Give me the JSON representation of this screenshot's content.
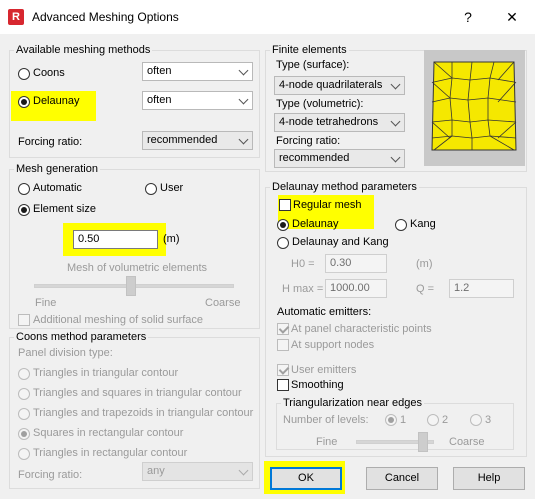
{
  "window": {
    "title": "Advanced Meshing Options",
    "help_glyph": "?",
    "close_glyph": "✕",
    "app_icon_text": "R"
  },
  "available_methods": {
    "title": "Available meshing methods",
    "coons_label": "Coons",
    "coons_select": "often",
    "delaunay_label": "Delaunay",
    "delaunay_select": "often",
    "forcing_label": "Forcing ratio:",
    "forcing_select": "recommended"
  },
  "finite_elements": {
    "title": "Finite elements",
    "surface_label": "Type (surface):",
    "surface_select": "4-node quadrilaterals",
    "volumetric_label": "Type (volumetric):",
    "volumetric_select": "4-node tetrahedrons",
    "forcing_label": "Forcing ratio:",
    "forcing_select": "recommended"
  },
  "mesh_generation": {
    "title": "Mesh generation",
    "automatic_label": "Automatic",
    "user_label": "User",
    "element_size_label": "Element size",
    "element_size_value": "0.50",
    "unit": "(m)",
    "volumetric_label": "Mesh of volumetric elements",
    "fine_label": "Fine",
    "coarse_label": "Coarse",
    "additional_label": "Additional meshing of solid surface"
  },
  "coons_params": {
    "title": "Coons method parameters",
    "division_label": "Panel division type:",
    "options": [
      "Triangles in triangular contour",
      "Triangles and squares in triangular contour",
      "Triangles and trapezoids in triangular contour",
      "Squares in rectangular contour",
      "Triangles in rectangular contour"
    ],
    "forcing_label": "Forcing ratio:",
    "forcing_select": "any"
  },
  "delaunay_params": {
    "title": "Delaunay method parameters",
    "regular_mesh_label": "Regular mesh",
    "delaunay_label": "Delaunay",
    "kang_label": "Kang",
    "delaunay_kang_label": "Delaunay and Kang",
    "h0_label": "H0 =",
    "h0_value": "0.30",
    "h0_unit": "(m)",
    "hmax_label": "H max =",
    "hmax_value": "1000.00",
    "q_label": "Q =",
    "q_value": "1.2",
    "auto_emitters_label": "Automatic emitters:",
    "panel_points_label": "At panel characteristic points",
    "support_nodes_label": "At support nodes",
    "user_emitters_label": "User emitters",
    "smoothing_label": "Smoothing"
  },
  "triangularization": {
    "title": "Triangularization near edges",
    "levels_label": "Number of levels:",
    "level_1": "1",
    "level_2": "2",
    "level_3": "3",
    "fine_label": "Fine",
    "coarse_label": "Coarse"
  },
  "buttons": {
    "ok": "OK",
    "cancel": "Cancel",
    "help": "Help"
  },
  "colors": {
    "highlight": "#ffff00",
    "mesh_fill": "#f5e800",
    "accent": "#0078d7"
  }
}
